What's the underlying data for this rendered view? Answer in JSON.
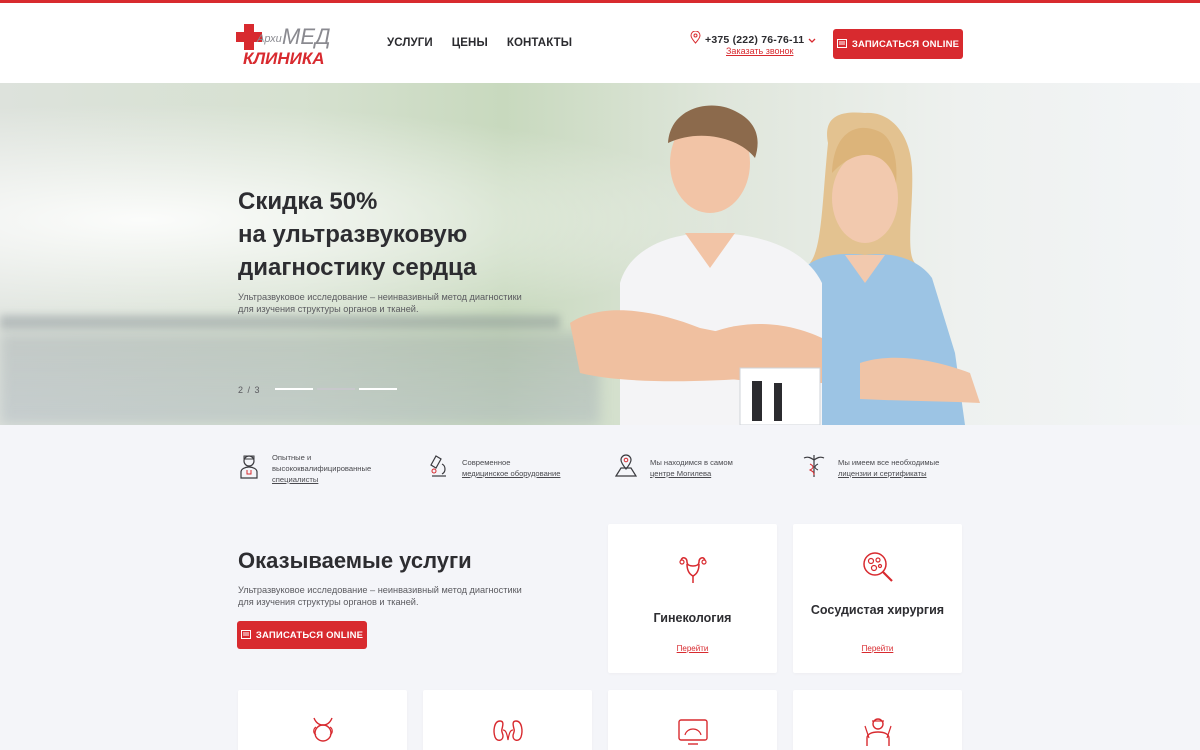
{
  "brand": {
    "logo_small": "Архи",
    "logo_big": "МЕД",
    "logo_bottom": "КЛИНИКА",
    "accent": "#d82a2f"
  },
  "nav": {
    "items": [
      "УСЛУГИ",
      "ЦЕНЫ",
      "КОНТАКТЫ"
    ]
  },
  "contact": {
    "phone": "+375 (222) 76-76-11",
    "callback": "Заказать звонок",
    "location_icon": "map-pin-icon",
    "dropdown_icon": "chevron-down-icon"
  },
  "header": {
    "cta_label": "ЗАПИСАТЬСЯ ONLINE"
  },
  "hero": {
    "title_lines": [
      "Скидка 50%",
      "на ультразвуковую",
      "диагностику сердца"
    ],
    "subtitle": "Ультразвуковое исследование – неинвазивный метод диагностики для изучения структуры органов и тканей.",
    "counter": "2 / 3",
    "slides_total": 3,
    "active_slide": 2
  },
  "features": [
    {
      "icon": "doctor-icon",
      "text": "Опытные и высококвалифицированные",
      "link": "специалисты"
    },
    {
      "icon": "microscope-icon",
      "text": "Современное",
      "link": "медицинское оборудование"
    },
    {
      "icon": "map-location-icon",
      "text": "Мы находимся в самом",
      "link": "центре Могилева"
    },
    {
      "icon": "caduceus-icon",
      "text": "Мы имеем все необходимые",
      "link": "лицензии и сертификаты"
    }
  ],
  "services": {
    "title": "Оказываемые услуги",
    "subtitle": "Ультразвуковое исследование – неинвазивный метод диагностики для изучения структуры органов и тканей.",
    "cta_label": "ЗАПИСАТЬСЯ ONLINE",
    "cards": [
      {
        "name": "Гинекология",
        "link": "Перейти",
        "icon": "uterus-icon"
      },
      {
        "name": "Сосудистая хирургия",
        "link": "Перейти",
        "icon": "vessel-magnifier-icon"
      },
      {
        "name": "",
        "link": "",
        "icon": "thyroid-icon"
      },
      {
        "name": "",
        "link": "",
        "icon": "kidneys-icon"
      },
      {
        "name": "",
        "link": "",
        "icon": "ultrasound-monitor-icon"
      },
      {
        "name": "",
        "link": "",
        "icon": "surgeon-icon"
      }
    ]
  }
}
